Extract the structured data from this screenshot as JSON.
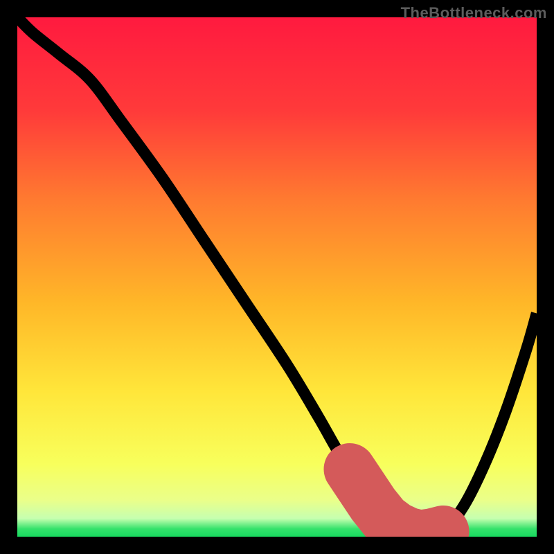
{
  "watermark": "TheBottleneck.com",
  "colors": {
    "frame": "#000000",
    "gradient_stops": [
      {
        "offset": 0.0,
        "color": "#ff1a3f"
      },
      {
        "offset": 0.18,
        "color": "#ff3a3a"
      },
      {
        "offset": 0.35,
        "color": "#ff7a30"
      },
      {
        "offset": 0.55,
        "color": "#ffb728"
      },
      {
        "offset": 0.72,
        "color": "#ffe63a"
      },
      {
        "offset": 0.86,
        "color": "#f8ff5c"
      },
      {
        "offset": 0.93,
        "color": "#eaff8a"
      },
      {
        "offset": 0.965,
        "color": "#c6ffb0"
      },
      {
        "offset": 0.985,
        "color": "#34e26b"
      },
      {
        "offset": 1.0,
        "color": "#18d95f"
      }
    ],
    "marker": "#d45a5a"
  },
  "chart_data": {
    "type": "line",
    "title": "",
    "xlabel": "",
    "ylabel": "",
    "xlim": [
      0,
      100
    ],
    "ylim": [
      0,
      100
    ],
    "series": [
      {
        "name": "bottleneck-curve",
        "x": [
          0,
          3,
          8,
          14,
          20,
          28,
          36,
          44,
          52,
          58,
          62,
          66,
          70,
          74,
          78,
          82,
          86,
          90,
          94,
          98,
          100
        ],
        "y": [
          100,
          97,
          93,
          88,
          80,
          69,
          57,
          45,
          33,
          23,
          16,
          10,
          4,
          1,
          0,
          1,
          6,
          14,
          24,
          36,
          43
        ]
      }
    ],
    "optimal_range_x": [
      64,
      82
    ],
    "annotations": []
  }
}
